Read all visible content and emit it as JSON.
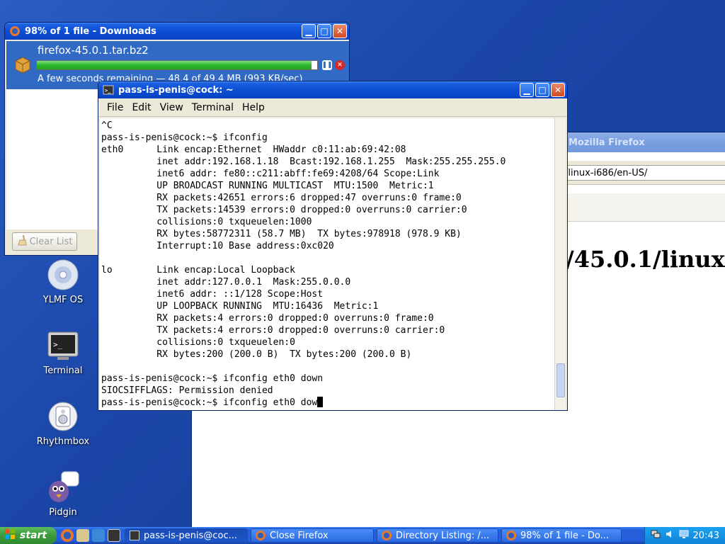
{
  "desktop": {
    "icons": [
      {
        "label": "YLMF OS",
        "icon": "cd-drive-icon"
      },
      {
        "label": "Terminal",
        "icon": "terminal-icon"
      },
      {
        "label": "Rhythmbox",
        "icon": "rhythmbox-icon"
      },
      {
        "label": "Pidgin",
        "icon": "pidgin-icon"
      }
    ]
  },
  "firefox": {
    "title": "Mozilla Firefox",
    "url": "/linux-i686/en-US/",
    "heading": "/45.0.1/linux-"
  },
  "downloads": {
    "title": "98% of 1 file - Downloads",
    "file_name": "firefox-45.0.1.tar.bz2",
    "progress": 0.98,
    "status": "A few seconds remaining — 48.4 of 49.4 MB (993 KB/sec)",
    "clear_button": "Clear List"
  },
  "terminal": {
    "title": "pass-is-penis@cock: ~",
    "menu": [
      "File",
      "Edit",
      "View",
      "Terminal",
      "Help"
    ],
    "lines": [
      "^C",
      "pass-is-penis@cock:~$ ifconfig",
      "eth0      Link encap:Ethernet  HWaddr c0:11:ab:69:42:08",
      "          inet addr:192.168.1.18  Bcast:192.168.1.255  Mask:255.255.255.0",
      "          inet6 addr: fe80::c211:abff:fe69:4208/64 Scope:Link",
      "          UP BROADCAST RUNNING MULTICAST  MTU:1500  Metric:1",
      "          RX packets:42651 errors:6 dropped:47 overruns:0 frame:0",
      "          TX packets:14539 errors:0 dropped:0 overruns:0 carrier:0",
      "          collisions:0 txqueuelen:1000",
      "          RX bytes:58772311 (58.7 MB)  TX bytes:978918 (978.9 KB)",
      "          Interrupt:10 Base address:0xc020",
      "",
      "lo        Link encap:Local Loopback",
      "          inet addr:127.0.0.1  Mask:255.0.0.0",
      "          inet6 addr: ::1/128 Scope:Host",
      "          UP LOOPBACK RUNNING  MTU:16436  Metric:1",
      "          RX packets:4 errors:0 dropped:0 overruns:0 frame:0",
      "          TX packets:4 errors:0 dropped:0 overruns:0 carrier:0",
      "          collisions:0 txqueuelen:0",
      "          RX bytes:200 (200.0 B)  TX bytes:200 (200.0 B)",
      "",
      "pass-is-penis@cock:~$ ifconfig eth0 down",
      "SIOCSIFFLAGS: Permission denied",
      "pass-is-penis@cock:~$ ifconfig eth0 dow"
    ]
  },
  "taskbar": {
    "start_label": "start",
    "tasks": [
      {
        "label": "pass-is-penis@coc...",
        "active": true
      },
      {
        "label": "Close Firefox",
        "active": false
      },
      {
        "label": "Directory Listing: /...",
        "active": false
      },
      {
        "label": "98% of 1 file - Do...",
        "active": false
      }
    ],
    "clock": "20:43"
  },
  "colors": {
    "titlebar_active": "#0a4bd1",
    "selection": "#316ac5",
    "progress_green": "#2bb52b",
    "desktop_blue": "#1b47a8"
  }
}
